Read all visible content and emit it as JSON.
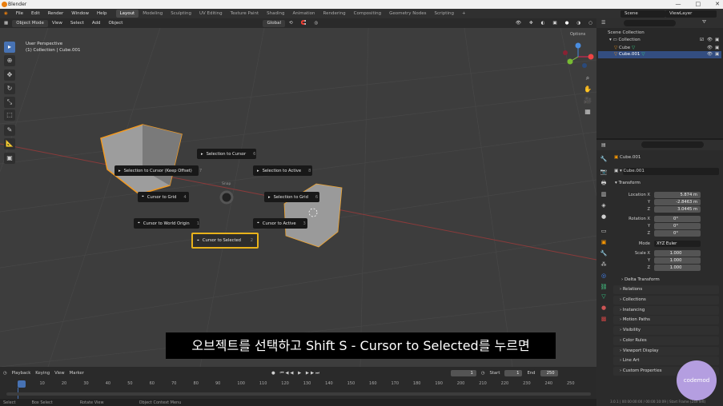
{
  "app": {
    "title": "Blender"
  },
  "window": {
    "minimize": "—",
    "maximize": "□",
    "close": "✕"
  },
  "menu": [
    "File",
    "Edit",
    "Render",
    "Window",
    "Help"
  ],
  "workspaces": [
    "Layout",
    "Modeling",
    "Sculpting",
    "UV Editing",
    "Texture Paint",
    "Shading",
    "Animation",
    "Rendering",
    "Compositing",
    "Geometry Nodes",
    "Scripting",
    "+"
  ],
  "scene": {
    "label": "Scene",
    "view_layer": "ViewLayer"
  },
  "viewport_header": {
    "mode": "Object Mode",
    "menus": [
      "View",
      "Select",
      "Add",
      "Object"
    ],
    "orientation": "Global",
    "options": "Options"
  },
  "viewport": {
    "perspective": "User Perspective",
    "collection": "(1) Collection | Cube.001"
  },
  "pie": {
    "center_label": "Snap",
    "items": [
      {
        "label": "Selection to Cursor",
        "key": "6"
      },
      {
        "label": "Selection to Cursor (Keep Offset)",
        "key": "7"
      },
      {
        "label": "Selection to Active",
        "key": "8"
      },
      {
        "label": "Cursor to Grid",
        "key": "4"
      },
      {
        "label": "Selection to Grid",
        "key": "6"
      },
      {
        "label": "Cursor to World Origin",
        "key": "1"
      },
      {
        "label": "Cursor to Active",
        "key": "3"
      },
      {
        "label": "Cursor to Selected",
        "key": "2"
      }
    ]
  },
  "subtitle": "오브젝트를 선택하고 Shift S - Cursor to Selected를 누르면",
  "timeline": {
    "menus": [
      "Playback",
      "Keying",
      "View",
      "Marker"
    ],
    "current_frame": "1",
    "start_label": "Start",
    "start": "1",
    "end_label": "End",
    "end": "250",
    "ticks": [
      "1",
      "10",
      "20",
      "30",
      "40",
      "50",
      "60",
      "70",
      "80",
      "90",
      "100",
      "110",
      "120",
      "130",
      "140",
      "150",
      "160",
      "170",
      "180",
      "190",
      "200",
      "210",
      "220",
      "230",
      "240",
      "250"
    ]
  },
  "outliner": {
    "root": "Scene Collection",
    "collection": "Collection",
    "items": [
      "Cube",
      "Cube.001"
    ]
  },
  "properties": {
    "object_name": "Cube.001",
    "data_name": "Cube.001",
    "transform_title": "Transform",
    "location_label": "Location X",
    "location": [
      "5.874 m",
      "-2.8463 m",
      "3.0445 m"
    ],
    "rotation_label": "Rotation X",
    "rotation": [
      "0°",
      "0°",
      "0°"
    ],
    "mode_label": "Mode",
    "mode": "XYZ Euler",
    "scale_label": "Scale X",
    "scale": [
      "1.000",
      "1.000",
      "1.000"
    ],
    "axis_y": "Y",
    "axis_z": "Z",
    "delta": "Delta Transform",
    "sections": [
      "Relations",
      "Collections",
      "Instancing",
      "Motion Paths",
      "Visibility",
      "Color Rules",
      "Viewport Display",
      "Line Art",
      "Custom Properties"
    ]
  },
  "status": {
    "items": [
      "Select",
      "Box Select",
      "Rotate View",
      "Object Context Menu"
    ],
    "version": "3.0.1 | 00:00:00:00 / 00:00:10:09 | Start Frame (249 left)"
  },
  "watermark": "codemod"
}
